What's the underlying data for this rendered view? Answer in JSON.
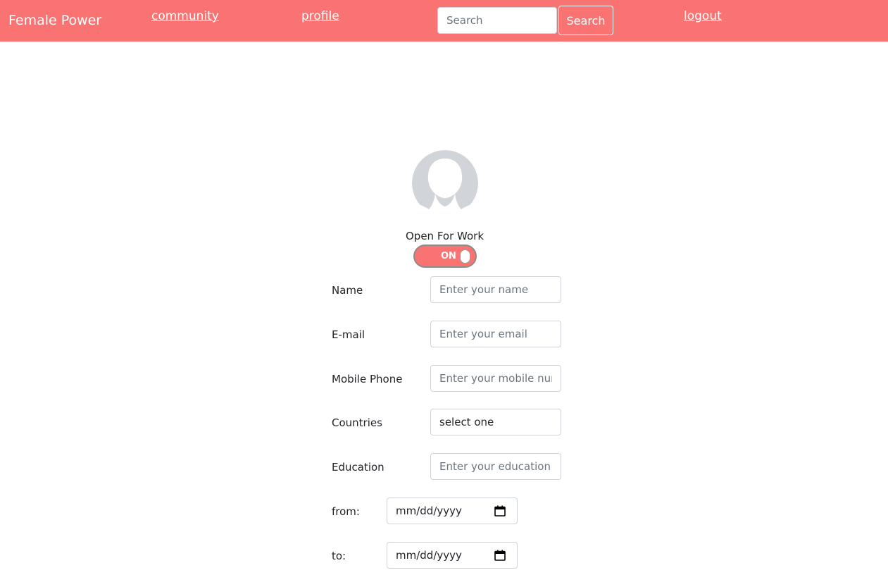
{
  "navbar": {
    "brand": "Female Power",
    "links": {
      "community": "community",
      "profile": "profile",
      "logout": "logout"
    },
    "search": {
      "placeholder": "Search",
      "button_label": "Search"
    },
    "background_color": "#f87371"
  },
  "profile": {
    "open_for_work_label": "Open For Work",
    "toggle_state": "ON",
    "avatar_icon": "user-silhouette-icon"
  },
  "form": {
    "name": {
      "label": "Name",
      "placeholder": "Enter your name"
    },
    "email": {
      "label": "E-mail",
      "placeholder": "Enter your email"
    },
    "mobile": {
      "label": "Mobile Phone",
      "placeholder": "Enter your mobile number"
    },
    "countries": {
      "label": "Countries",
      "selected": "select one"
    },
    "education": {
      "label": "Education",
      "placeholder": "Enter your education"
    },
    "from": {
      "label": "from:",
      "value": "mm/dd/yyyy"
    },
    "to": {
      "label": "to:",
      "value": "mm/dd/yyyy"
    }
  }
}
